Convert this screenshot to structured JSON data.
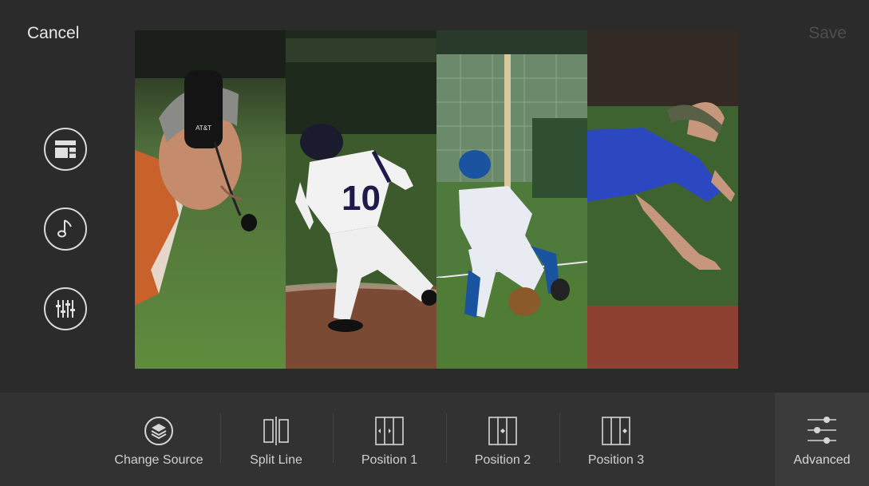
{
  "header": {
    "cancel_label": "Cancel",
    "save_label": "Save"
  },
  "side_tools": [
    {
      "icon": "layout-icon"
    },
    {
      "icon": "music-note-icon"
    },
    {
      "icon": "equalizer-icon"
    }
  ],
  "collage": {
    "panels": [
      {
        "subject": "coach-with-headset",
        "headset_text": "AT&T"
      },
      {
        "subject": "runner-number-10",
        "jersey_number": "10"
      },
      {
        "subject": "infielder-fielding"
      },
      {
        "subject": "diving-player"
      }
    ]
  },
  "toolbar": {
    "items": [
      {
        "label": "Change Source",
        "icon": "layers-icon"
      },
      {
        "label": "Split Line",
        "icon": "split-line-icon"
      },
      {
        "label": "Position 1",
        "icon": "position-1-icon"
      },
      {
        "label": "Position 2",
        "icon": "position-2-icon"
      },
      {
        "label": "Position 3",
        "icon": "position-3-icon"
      }
    ],
    "advanced_label": "Advanced"
  },
  "colors": {
    "background": "#2b2b2b",
    "toolbar": "#323232",
    "advanced_bg": "#3b3b3b",
    "save_disabled": "#4e4e4e"
  }
}
